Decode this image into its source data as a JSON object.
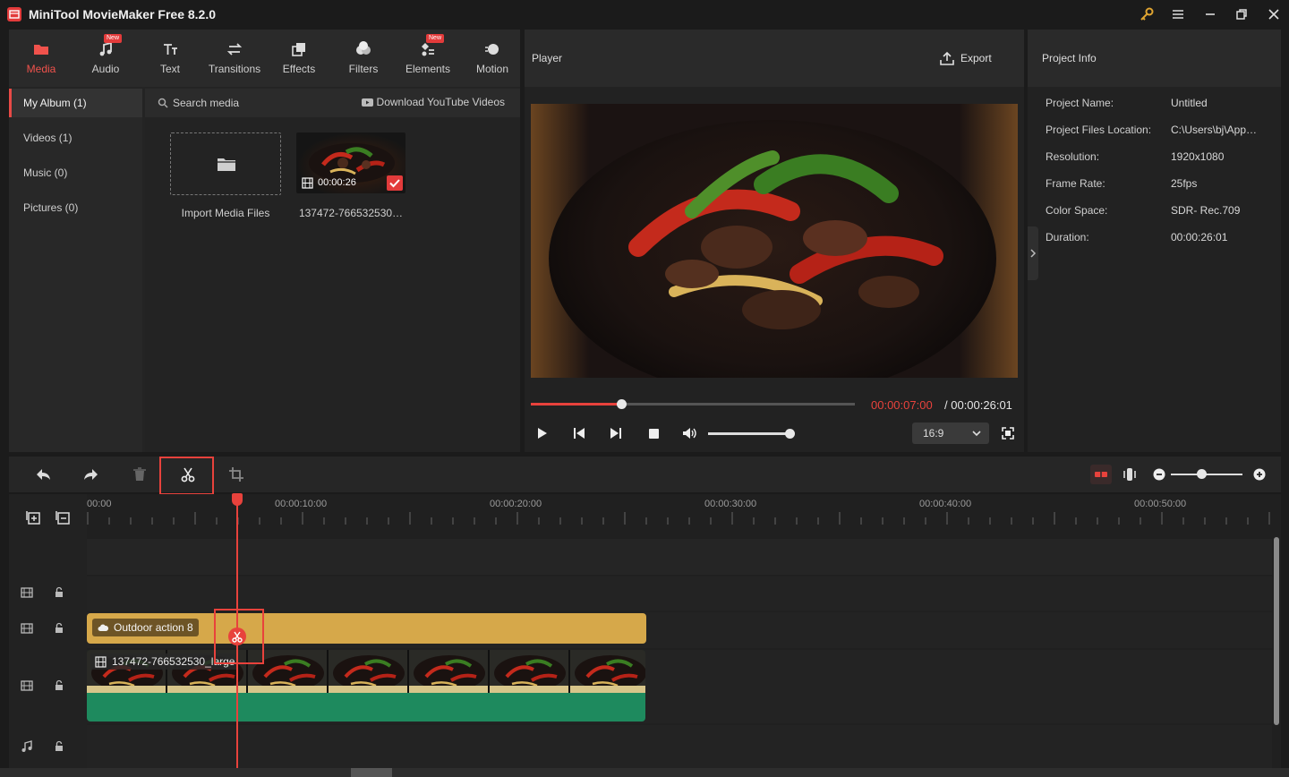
{
  "app": {
    "title": "MiniTool MovieMaker Free 8.2.0"
  },
  "tabs": [
    {
      "label": "Media",
      "icon": "media-folder-icon",
      "active": true
    },
    {
      "label": "Audio",
      "icon": "music-note-icon",
      "badge": "New"
    },
    {
      "label": "Text",
      "icon": "text-icon"
    },
    {
      "label": "Transitions",
      "icon": "transitions-icon"
    },
    {
      "label": "Effects",
      "icon": "effects-icon"
    },
    {
      "label": "Filters",
      "icon": "filters-icon"
    },
    {
      "label": "Elements",
      "icon": "elements-icon",
      "badge": "New"
    },
    {
      "label": "Motion",
      "icon": "motion-icon"
    }
  ],
  "album": {
    "items": [
      "My Album (1)",
      "Videos (1)",
      "Music (0)",
      "Pictures (0)"
    ]
  },
  "media": {
    "search_label": "Search media",
    "download_label": "Download YouTube Videos",
    "import_label": "Import Media Files",
    "clip_time": "00:00:26",
    "clip_name": "137472-766532530…"
  },
  "player": {
    "title": "Player",
    "export_label": "Export",
    "time_current": "00:00:07:00",
    "time_separator": " / ",
    "time_total": "00:00:26:01",
    "progress_fraction": 0.28,
    "volume_fraction": 1.0,
    "aspect_ratio": "16:9"
  },
  "project_info": {
    "title": "Project Info",
    "rows": [
      {
        "key": "Project Name:",
        "value": "Untitled"
      },
      {
        "key": "Project Files Location:",
        "value": "C:\\Users\\bj\\App…"
      },
      {
        "key": "Resolution:",
        "value": "1920x1080"
      },
      {
        "key": "Frame Rate:",
        "value": "25fps"
      },
      {
        "key": "Color Space:",
        "value": "SDR- Rec.709"
      },
      {
        "key": "Duration:",
        "value": "00:00:26:01"
      }
    ]
  },
  "timeline": {
    "ruler_labels": [
      "00:00",
      "00:00:10:00",
      "00:00:20:00",
      "00:00:30:00",
      "00:00:40:00",
      "00:00:50:00"
    ],
    "music_clip_label": "Outdoor action 8",
    "video_clip_label": "137472-766532530_large",
    "zoom_fraction": 0.55
  },
  "colors": {
    "accent": "#e8423c",
    "music_clip": "#d6a84a",
    "video_clip": "#1e8a5e"
  }
}
